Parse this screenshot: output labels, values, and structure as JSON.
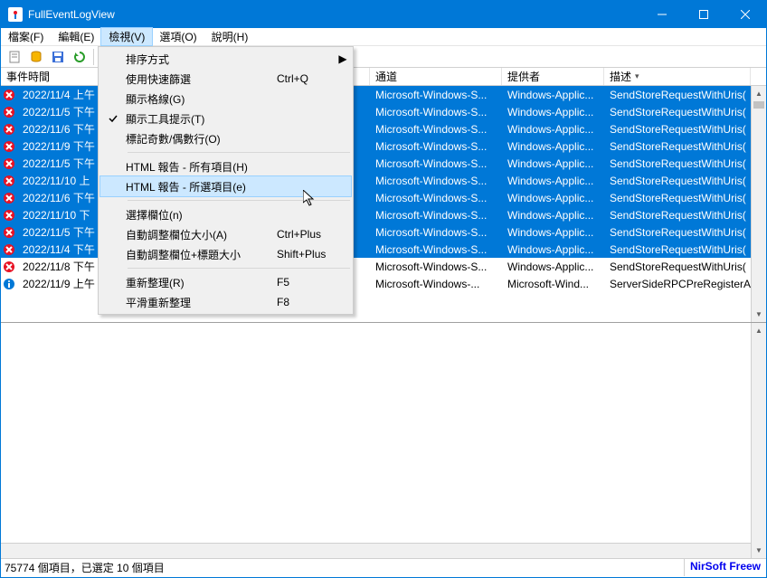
{
  "app_title": "FullEventLogView",
  "menubar": {
    "items": [
      "檔案(F)",
      "編輯(E)",
      "檢視(V)",
      "選項(O)",
      "說明(H)"
    ],
    "active_index": 2
  },
  "columns": {
    "c0": "事件時間",
    "c4": "通道",
    "c5": "提供者",
    "c6": "描述",
    "sort_indicator": "▾"
  },
  "col_widths": {
    "c0": 112,
    "gap": 296,
    "c4": 146,
    "c5": 113,
    "c6": 162
  },
  "rows": [
    {
      "sel": true,
      "icon": "err",
      "time": "2022/11/4 上午",
      "ch": "Microsoft-Windows-S...",
      "prov": "Windows-Applic...",
      "desc": "SendStoreRequestWithUris("
    },
    {
      "sel": true,
      "icon": "err",
      "time": "2022/11/5 下午",
      "ch": "Microsoft-Windows-S...",
      "prov": "Windows-Applic...",
      "desc": "SendStoreRequestWithUris("
    },
    {
      "sel": true,
      "icon": "err",
      "time": "2022/11/6 下午",
      "ch": "Microsoft-Windows-S...",
      "prov": "Windows-Applic...",
      "desc": "SendStoreRequestWithUris("
    },
    {
      "sel": true,
      "icon": "err",
      "time": "2022/11/9 下午",
      "ch": "Microsoft-Windows-S...",
      "prov": "Windows-Applic...",
      "desc": "SendStoreRequestWithUris("
    },
    {
      "sel": true,
      "icon": "err",
      "time": "2022/11/5 下午",
      "ch": "Microsoft-Windows-S...",
      "prov": "Windows-Applic...",
      "desc": "SendStoreRequestWithUris("
    },
    {
      "sel": true,
      "icon": "err",
      "time": "2022/11/10 上",
      "ch": "Microsoft-Windows-S...",
      "prov": "Windows-Applic...",
      "desc": "SendStoreRequestWithUris("
    },
    {
      "sel": true,
      "icon": "err",
      "time": "2022/11/6 下午",
      "ch": "Microsoft-Windows-S...",
      "prov": "Windows-Applic...",
      "desc": "SendStoreRequestWithUris("
    },
    {
      "sel": true,
      "icon": "err",
      "time": "2022/11/10 下",
      "ch": "Microsoft-Windows-S...",
      "prov": "Windows-Applic...",
      "desc": "SendStoreRequestWithUris("
    },
    {
      "sel": true,
      "icon": "err",
      "time": "2022/11/5 下午",
      "ch": "Microsoft-Windows-S...",
      "prov": "Windows-Applic...",
      "desc": "SendStoreRequestWithUris("
    },
    {
      "sel": true,
      "icon": "err",
      "time": "2022/11/4 下午",
      "ch": "Microsoft-Windows-S...",
      "prov": "Windows-Applic...",
      "desc": "SendStoreRequestWithUris("
    },
    {
      "sel": false,
      "icon": "err",
      "time": "2022/11/8 下午",
      "ch": "Microsoft-Windows-S...",
      "prov": "Windows-Applic...",
      "desc": "SendStoreRequestWithUris("
    },
    {
      "sel": false,
      "icon": "info",
      "time": "2022/11/9 上午",
      "ch": "Microsoft-Windows-...",
      "prov": "Microsoft-Wind...",
      "desc": "ServerSideRPCPreRegisterA"
    }
  ],
  "dropdown": [
    {
      "type": "item",
      "label": "排序方式",
      "sub": true
    },
    {
      "type": "item",
      "label": "使用快速篩選",
      "shortcut": "Ctrl+Q"
    },
    {
      "type": "item",
      "label": "顯示格線(G)"
    },
    {
      "type": "item",
      "label": "顯示工具提示(T)",
      "checked": true
    },
    {
      "type": "item",
      "label": "標記奇數/偶數行(O)"
    },
    {
      "type": "sep"
    },
    {
      "type": "item",
      "label": "HTML 報告 - 所有項目(H)"
    },
    {
      "type": "item",
      "label": "HTML 報告 - 所選項目(e)",
      "hl": true
    },
    {
      "type": "sep"
    },
    {
      "type": "item",
      "label": "選擇欄位(n)"
    },
    {
      "type": "item",
      "label": "自動調整欄位大小(A)",
      "shortcut": "Ctrl+Plus"
    },
    {
      "type": "item",
      "label": "自動調整欄位+標題大小",
      "shortcut": "Shift+Plus"
    },
    {
      "type": "sep"
    },
    {
      "type": "item",
      "label": "重新整理(R)",
      "shortcut": "F5"
    },
    {
      "type": "item",
      "label": "平滑重新整理",
      "shortcut": "F8"
    }
  ],
  "status": {
    "left": "75774 個項目，已選定 10 個項目",
    "right": "NirSoft Freew"
  }
}
